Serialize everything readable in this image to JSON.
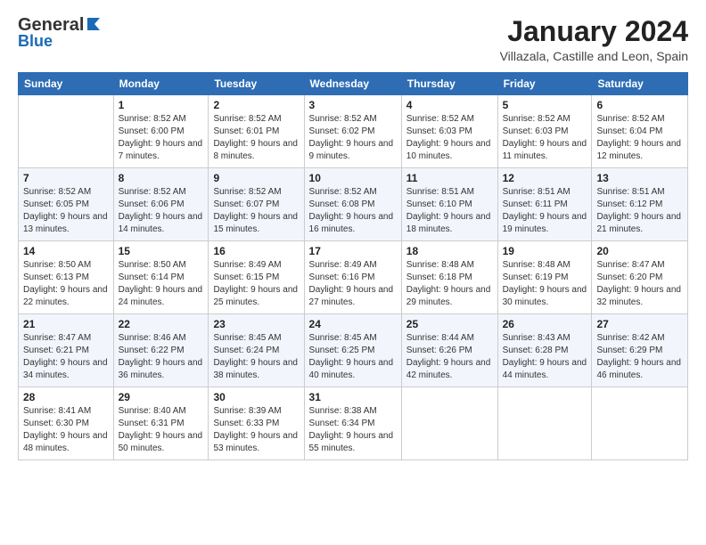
{
  "header": {
    "logo_general": "General",
    "logo_blue": "Blue",
    "month_year": "January 2024",
    "location": "Villazala, Castille and Leon, Spain"
  },
  "days_of_week": [
    "Sunday",
    "Monday",
    "Tuesday",
    "Wednesday",
    "Thursday",
    "Friday",
    "Saturday"
  ],
  "weeks": [
    [
      {
        "day": "",
        "sunrise": "",
        "sunset": "",
        "daylight": ""
      },
      {
        "day": "1",
        "sunrise": "Sunrise: 8:52 AM",
        "sunset": "Sunset: 6:00 PM",
        "daylight": "Daylight: 9 hours and 7 minutes."
      },
      {
        "day": "2",
        "sunrise": "Sunrise: 8:52 AM",
        "sunset": "Sunset: 6:01 PM",
        "daylight": "Daylight: 9 hours and 8 minutes."
      },
      {
        "day": "3",
        "sunrise": "Sunrise: 8:52 AM",
        "sunset": "Sunset: 6:02 PM",
        "daylight": "Daylight: 9 hours and 9 minutes."
      },
      {
        "day": "4",
        "sunrise": "Sunrise: 8:52 AM",
        "sunset": "Sunset: 6:03 PM",
        "daylight": "Daylight: 9 hours and 10 minutes."
      },
      {
        "day": "5",
        "sunrise": "Sunrise: 8:52 AM",
        "sunset": "Sunset: 6:03 PM",
        "daylight": "Daylight: 9 hours and 11 minutes."
      },
      {
        "day": "6",
        "sunrise": "Sunrise: 8:52 AM",
        "sunset": "Sunset: 6:04 PM",
        "daylight": "Daylight: 9 hours and 12 minutes."
      }
    ],
    [
      {
        "day": "7",
        "sunrise": "Sunrise: 8:52 AM",
        "sunset": "Sunset: 6:05 PM",
        "daylight": "Daylight: 9 hours and 13 minutes."
      },
      {
        "day": "8",
        "sunrise": "Sunrise: 8:52 AM",
        "sunset": "Sunset: 6:06 PM",
        "daylight": "Daylight: 9 hours and 14 minutes."
      },
      {
        "day": "9",
        "sunrise": "Sunrise: 8:52 AM",
        "sunset": "Sunset: 6:07 PM",
        "daylight": "Daylight: 9 hours and 15 minutes."
      },
      {
        "day": "10",
        "sunrise": "Sunrise: 8:52 AM",
        "sunset": "Sunset: 6:08 PM",
        "daylight": "Daylight: 9 hours and 16 minutes."
      },
      {
        "day": "11",
        "sunrise": "Sunrise: 8:51 AM",
        "sunset": "Sunset: 6:10 PM",
        "daylight": "Daylight: 9 hours and 18 minutes."
      },
      {
        "day": "12",
        "sunrise": "Sunrise: 8:51 AM",
        "sunset": "Sunset: 6:11 PM",
        "daylight": "Daylight: 9 hours and 19 minutes."
      },
      {
        "day": "13",
        "sunrise": "Sunrise: 8:51 AM",
        "sunset": "Sunset: 6:12 PM",
        "daylight": "Daylight: 9 hours and 21 minutes."
      }
    ],
    [
      {
        "day": "14",
        "sunrise": "Sunrise: 8:50 AM",
        "sunset": "Sunset: 6:13 PM",
        "daylight": "Daylight: 9 hours and 22 minutes."
      },
      {
        "day": "15",
        "sunrise": "Sunrise: 8:50 AM",
        "sunset": "Sunset: 6:14 PM",
        "daylight": "Daylight: 9 hours and 24 minutes."
      },
      {
        "day": "16",
        "sunrise": "Sunrise: 8:49 AM",
        "sunset": "Sunset: 6:15 PM",
        "daylight": "Daylight: 9 hours and 25 minutes."
      },
      {
        "day": "17",
        "sunrise": "Sunrise: 8:49 AM",
        "sunset": "Sunset: 6:16 PM",
        "daylight": "Daylight: 9 hours and 27 minutes."
      },
      {
        "day": "18",
        "sunrise": "Sunrise: 8:48 AM",
        "sunset": "Sunset: 6:18 PM",
        "daylight": "Daylight: 9 hours and 29 minutes."
      },
      {
        "day": "19",
        "sunrise": "Sunrise: 8:48 AM",
        "sunset": "Sunset: 6:19 PM",
        "daylight": "Daylight: 9 hours and 30 minutes."
      },
      {
        "day": "20",
        "sunrise": "Sunrise: 8:47 AM",
        "sunset": "Sunset: 6:20 PM",
        "daylight": "Daylight: 9 hours and 32 minutes."
      }
    ],
    [
      {
        "day": "21",
        "sunrise": "Sunrise: 8:47 AM",
        "sunset": "Sunset: 6:21 PM",
        "daylight": "Daylight: 9 hours and 34 minutes."
      },
      {
        "day": "22",
        "sunrise": "Sunrise: 8:46 AM",
        "sunset": "Sunset: 6:22 PM",
        "daylight": "Daylight: 9 hours and 36 minutes."
      },
      {
        "day": "23",
        "sunrise": "Sunrise: 8:45 AM",
        "sunset": "Sunset: 6:24 PM",
        "daylight": "Daylight: 9 hours and 38 minutes."
      },
      {
        "day": "24",
        "sunrise": "Sunrise: 8:45 AM",
        "sunset": "Sunset: 6:25 PM",
        "daylight": "Daylight: 9 hours and 40 minutes."
      },
      {
        "day": "25",
        "sunrise": "Sunrise: 8:44 AM",
        "sunset": "Sunset: 6:26 PM",
        "daylight": "Daylight: 9 hours and 42 minutes."
      },
      {
        "day": "26",
        "sunrise": "Sunrise: 8:43 AM",
        "sunset": "Sunset: 6:28 PM",
        "daylight": "Daylight: 9 hours and 44 minutes."
      },
      {
        "day": "27",
        "sunrise": "Sunrise: 8:42 AM",
        "sunset": "Sunset: 6:29 PM",
        "daylight": "Daylight: 9 hours and 46 minutes."
      }
    ],
    [
      {
        "day": "28",
        "sunrise": "Sunrise: 8:41 AM",
        "sunset": "Sunset: 6:30 PM",
        "daylight": "Daylight: 9 hours and 48 minutes."
      },
      {
        "day": "29",
        "sunrise": "Sunrise: 8:40 AM",
        "sunset": "Sunset: 6:31 PM",
        "daylight": "Daylight: 9 hours and 50 minutes."
      },
      {
        "day": "30",
        "sunrise": "Sunrise: 8:39 AM",
        "sunset": "Sunset: 6:33 PM",
        "daylight": "Daylight: 9 hours and 53 minutes."
      },
      {
        "day": "31",
        "sunrise": "Sunrise: 8:38 AM",
        "sunset": "Sunset: 6:34 PM",
        "daylight": "Daylight: 9 hours and 55 minutes."
      },
      {
        "day": "",
        "sunrise": "",
        "sunset": "",
        "daylight": ""
      },
      {
        "day": "",
        "sunrise": "",
        "sunset": "",
        "daylight": ""
      },
      {
        "day": "",
        "sunrise": "",
        "sunset": "",
        "daylight": ""
      }
    ]
  ]
}
